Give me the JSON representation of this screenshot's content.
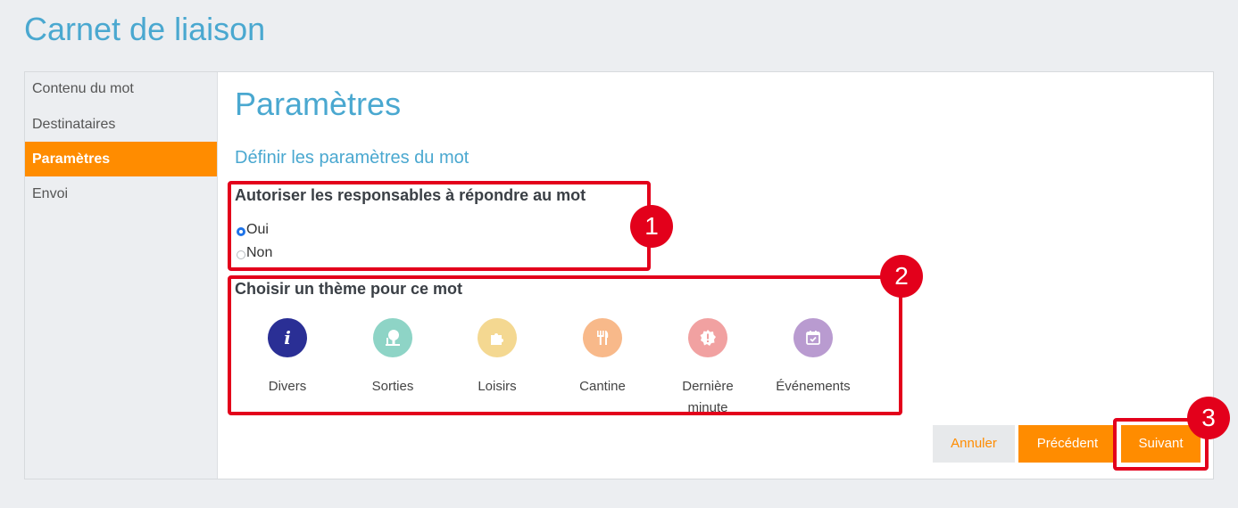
{
  "page": {
    "title": "Carnet de liaison"
  },
  "sidebar": {
    "items": [
      {
        "label": "Contenu du mot"
      },
      {
        "label": "Destinataires"
      },
      {
        "label": "Paramètres"
      },
      {
        "label": "Envoi"
      }
    ],
    "active_color": "#ff8c00"
  },
  "main": {
    "title": "Paramètres",
    "subtitle": "Définir les paramètres du mot",
    "reply_question": "Autoriser les responsables à répondre au mot",
    "reply_options": [
      {
        "label": "Oui",
        "checked": true
      },
      {
        "label": "Non",
        "checked": false
      }
    ],
    "theme_question": "Choisir un thème pour ce mot",
    "themes": [
      {
        "label": "Divers",
        "icon": "info-icon",
        "color": "#2a2f95"
      },
      {
        "label": "Sorties",
        "icon": "tree-icon",
        "color": "#8ed4c6"
      },
      {
        "label": "Loisirs",
        "icon": "puzzle-icon",
        "color": "#f4d891"
      },
      {
        "label": "Cantine",
        "icon": "cutlery-icon",
        "color": "#f8b98a"
      },
      {
        "label": "Dernière minute",
        "icon": "alert-icon",
        "color": "#f1a1a1"
      },
      {
        "label": "Événements",
        "icon": "calendar-icon",
        "color": "#b99bd0"
      }
    ]
  },
  "buttons": {
    "cancel": "Annuler",
    "previous": "Précédent",
    "next": "Suivant"
  },
  "annotations": {
    "badges": [
      "1",
      "2",
      "3"
    ],
    "color": "#e3001b"
  }
}
